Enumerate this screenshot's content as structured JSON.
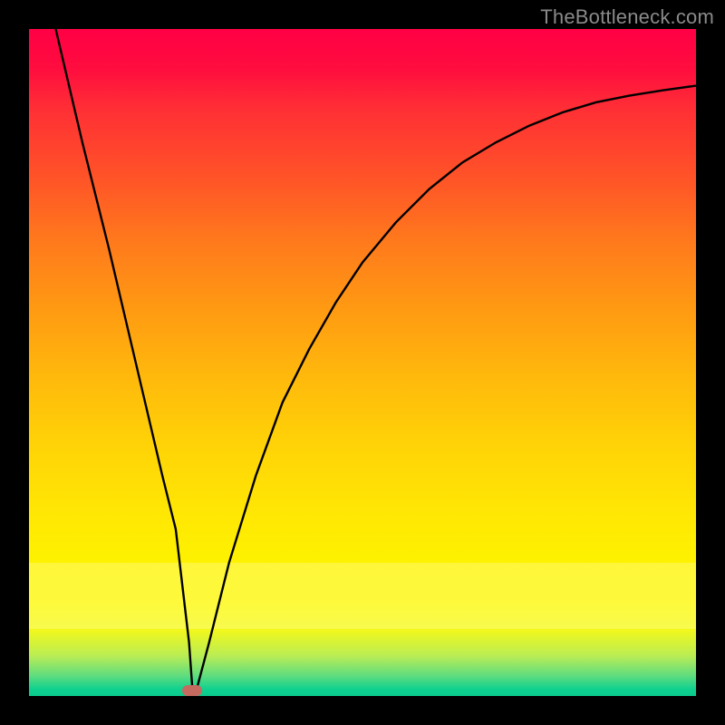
{
  "watermark": {
    "text": "TheBottleneck.com"
  },
  "colors": {
    "frame_bg": "#000000",
    "curve_stroke": "#000000",
    "marker_fill": "#c46a5f",
    "gradient_top": "#ff0044",
    "gradient_mid": "#ffe604",
    "gradient_bottom": "#0acb8c"
  },
  "min_marker": {
    "x_frac": 0.245,
    "y_frac": 0.992
  },
  "chart_data": {
    "type": "line",
    "title": "",
    "xlabel": "",
    "ylabel": "",
    "xlim": [
      0,
      100
    ],
    "ylim": [
      0,
      100
    ],
    "grid": false,
    "legend": false,
    "annotations": [
      {
        "text": "TheBottleneck.com",
        "position": "top-right"
      }
    ],
    "series": [
      {
        "name": "bottleneck-curve",
        "x": [
          4,
          8,
          12,
          16,
          20,
          22,
          24,
          24.5,
          25,
          27,
          30,
          34,
          38,
          42,
          46,
          50,
          55,
          60,
          65,
          70,
          75,
          80,
          85,
          90,
          95,
          100
        ],
        "values": [
          100,
          83,
          67,
          50,
          33,
          25,
          8,
          1,
          0.5,
          8,
          20,
          33,
          44,
          52,
          59,
          65,
          71,
          76,
          80,
          83,
          85.5,
          87.5,
          89,
          90,
          90.8,
          91.5
        ]
      }
    ],
    "min_point": {
      "x": 24.5,
      "y": 0.5
    }
  }
}
